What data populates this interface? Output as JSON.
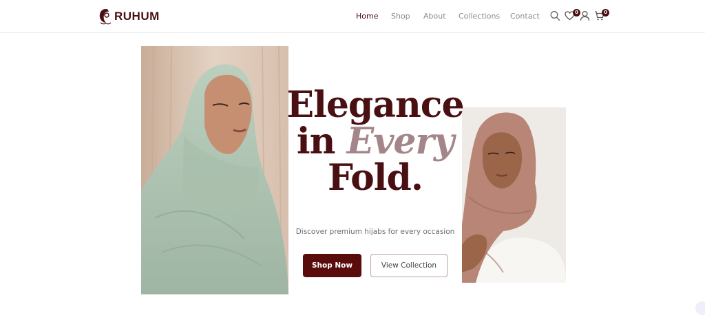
{
  "brand": {
    "name": "RUHUM"
  },
  "nav": {
    "items": [
      {
        "label": "Home",
        "active": true
      },
      {
        "label": "Shop",
        "active": false
      },
      {
        "label": "About",
        "active": false
      },
      {
        "label": "Collections",
        "active": false
      },
      {
        "label": "Contact",
        "active": false
      }
    ]
  },
  "header_icons": {
    "search": "search-icon",
    "wishlist": {
      "icon": "heart-icon",
      "count": "0"
    },
    "account": "user-icon",
    "cart": {
      "icon": "cart-icon",
      "count": "0"
    }
  },
  "hero": {
    "headline": {
      "line1": "Elegance",
      "line2_prefix": "in",
      "line2_accent": "Every",
      "line3": "Fold."
    },
    "subtitle": "Discover premium hijabs for every occasion",
    "primary_button": "Shop Now",
    "secondary_button": "View Collection"
  },
  "colors": {
    "brand": "#4a0f12",
    "accent": "#a4868a",
    "primary_button_bg": "#5a0c0c",
    "nav_text": "#8a8a8a"
  }
}
